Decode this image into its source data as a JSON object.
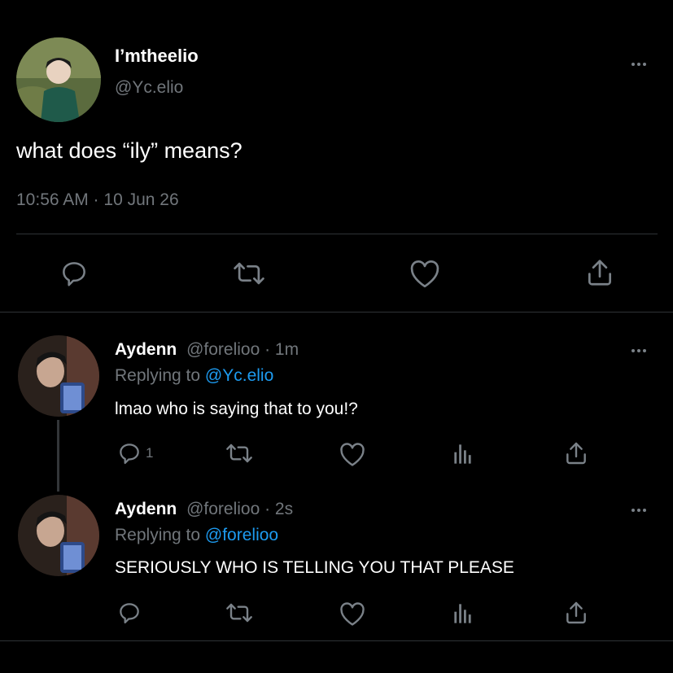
{
  "main_tweet": {
    "display_name": "I’mtheelio",
    "handle": "@Yc.elio",
    "text": "what does “ily” means?",
    "timestamp": "10:56 AM · 10 Jun 26"
  },
  "replies": [
    {
      "display_name": "Aydenn",
      "handle_time": "@forelioo · 1m",
      "replying_prefix": "Replying to ",
      "replying_to": "@Yc.elio",
      "text": "lmao who is saying that to you!?",
      "reply_count": "1"
    },
    {
      "display_name": "Aydenn",
      "handle_time": "@forelioo · 2s",
      "replying_prefix": "Replying to ",
      "replying_to": "@forelioo",
      "text": "SERIOUSLY WHO IS TELLING YOU THAT PLEASE",
      "reply_count": ""
    }
  ],
  "icons": [
    "more-icon",
    "reply-icon",
    "retweet-icon",
    "like-icon",
    "share-icon",
    "analytics-icon"
  ],
  "colors": {
    "background": "#000000",
    "muted": "#71767b",
    "link": "#1d9bf0",
    "divider": "#2f3336"
  }
}
